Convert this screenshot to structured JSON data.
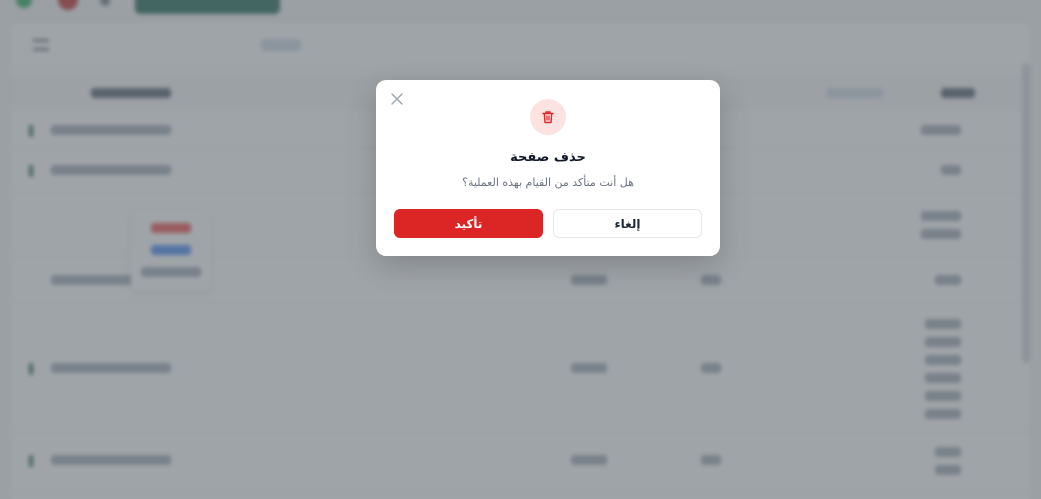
{
  "dialog": {
    "title": "حذف صفحة",
    "message": "هل أنت متأكد من القيام بهذه العملية؟",
    "cancel_label": "إلغاء",
    "confirm_label": "تأكيد",
    "close_icon": "close-icon",
    "trash_icon": "trash-icon"
  },
  "colors": {
    "danger": "#dc2626",
    "danger_soft": "#fde2e2",
    "brand": "#0f5d49",
    "overlay": "rgba(100,108,115,0.62)"
  }
}
